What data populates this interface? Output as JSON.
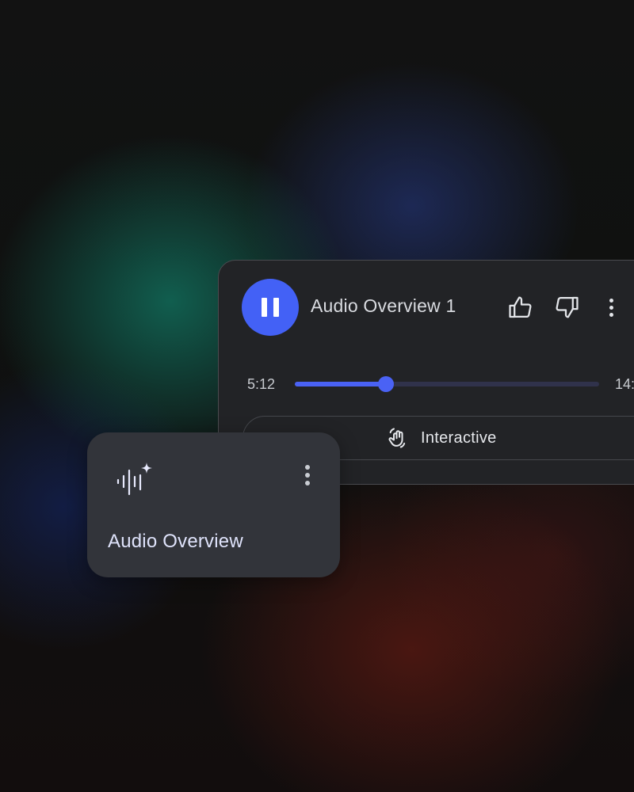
{
  "player": {
    "title": "Audio Overview 1",
    "current_time": "5:12",
    "duration": "14:",
    "progress_fraction": 0.3,
    "accent_color": "#4361f6",
    "interactive_label": "Interactive",
    "icons": {
      "play_pause": "pause-icon",
      "like": "thumbs-up-icon",
      "dislike": "thumbs-down-icon",
      "more": "more-vert-icon",
      "interactive": "waving-hand-icon"
    }
  },
  "mini_card": {
    "title": "Audio Overview",
    "icons": {
      "main": "audio-sparkle-icon",
      "more": "more-vert-icon"
    }
  }
}
